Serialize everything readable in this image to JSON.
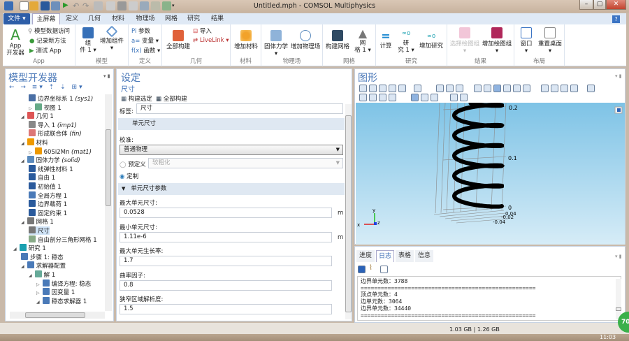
{
  "window": {
    "title": "Untitled.mph - COMSOL Multiphysics",
    "help": "?"
  },
  "menu_tabs": [
    "文件 ▾",
    "主屏幕",
    "定义",
    "几何",
    "材料",
    "物理场",
    "网格",
    "研究",
    "结果"
  ],
  "ribbon": {
    "app": {
      "group": "App",
      "big": "App\n开发器",
      "items": [
        "模型数据访问",
        "记录新方法",
        "测试 App"
      ]
    },
    "model": {
      "group": "模型",
      "component": "组\n件 1 ▾",
      "add_component": "增加组件\n▾"
    },
    "definitions": {
      "group": "定义",
      "items": [
        "参数",
        "变量 ▾",
        "函数 ▾"
      ],
      "prefix": [
        "Pi",
        "a=",
        "f(x)"
      ]
    },
    "geometry": {
      "group": "几何",
      "build_all": "全部构建",
      "import": "导入",
      "livelink": "LiveLink ▾"
    },
    "materials": {
      "group": "材料",
      "add": "增加材料"
    },
    "physics": {
      "group": "物理场",
      "solid": "固体力学\n▾",
      "add": "增加物理场"
    },
    "mesh": {
      "group": "网格",
      "build": "构建网格",
      "mesh1": "网\n格 1 ▾"
    },
    "study": {
      "group": "研究",
      "compute": "计算",
      "study1": "研\n究 1 ▾",
      "add": "增加研究"
    },
    "results": {
      "group": "结果",
      "select": "选择绘图组\n▾",
      "add": "增加绘图组\n▾"
    },
    "layout": {
      "group": "布局",
      "window": "窗口\n▾",
      "reset": "重置桌面\n▾"
    }
  },
  "model_builder": {
    "title": "模型开发器",
    "tree": [
      {
        "label": "边界坐标系 1",
        "tag": "(sys1)"
      },
      {
        "label": "视图 1",
        "tag": ""
      },
      {
        "label": "几何 1",
        "tag": ""
      },
      {
        "label": "导入 1",
        "tag": "(imp1)"
      },
      {
        "label": "形成联合体",
        "tag": "(fin)"
      },
      {
        "label": "材料",
        "tag": ""
      },
      {
        "label": "60Si2Mn",
        "tag": "(mat1)"
      },
      {
        "label": "固体力学",
        "tag": "(solid)"
      },
      {
        "label": "线弹性材料 1",
        "tag": ""
      },
      {
        "label": "自由 1",
        "tag": ""
      },
      {
        "label": "初始值 1",
        "tag": ""
      },
      {
        "label": "全局方程 1",
        "tag": ""
      },
      {
        "label": "边界载荷 1",
        "tag": ""
      },
      {
        "label": "固定约束 1",
        "tag": ""
      },
      {
        "label": "网格 1",
        "tag": ""
      },
      {
        "label": "尺寸",
        "tag": ""
      },
      {
        "label": "自由剖分三角形网格 1",
        "tag": ""
      },
      {
        "label": "研究 1",
        "tag": ""
      },
      {
        "label": "步骤 1: 稳态",
        "tag": ""
      },
      {
        "label": "求解器配置",
        "tag": ""
      },
      {
        "label": "解 1",
        "tag": ""
      },
      {
        "label": "编译方程: 稳态",
        "tag": ""
      },
      {
        "label": "因变量 1",
        "tag": ""
      },
      {
        "label": "稳态求解器 1",
        "tag": ""
      }
    ]
  },
  "settings": {
    "title": "设定",
    "subtitle": "尺寸",
    "build_selected": "构建选定",
    "build_all": "全部构建",
    "label_caption": "标签:",
    "label_value": "尺寸",
    "section1": "单元尺寸",
    "calibration_label": "校准:",
    "calibration_value": "普通物理",
    "predefined": "预定义",
    "predefined_value": "较粗化",
    "custom": "定制",
    "section2": "单元尺寸参数",
    "params": [
      {
        "label": "最大单元尺寸:",
        "value": "0.0528",
        "unit": "m"
      },
      {
        "label": "最小单元尺寸:",
        "value": "1.11e-6",
        "unit": "m"
      },
      {
        "label": "最大单元生长率:",
        "value": "1.7",
        "unit": ""
      },
      {
        "label": "曲率因子:",
        "value": "0.8",
        "unit": ""
      },
      {
        "label": "狭窄区域解析度:",
        "value": "1.5",
        "unit": ""
      }
    ]
  },
  "graphics": {
    "title": "图形",
    "axis_labels": [
      "0.2",
      "0.1",
      "0",
      "0.04",
      "-0.02",
      "-0.04"
    ],
    "triad": [
      "x",
      "y",
      "z"
    ]
  },
  "log": {
    "tabs": [
      "进度",
      "日志",
      "表格",
      "信息"
    ],
    "active": 1,
    "lines": [
      "边界单元数：3788",
      "====================================================",
      "顶点单元数：4",
      "边单元数：3064",
      "边界单元数：34440",
      "===================================================="
    ]
  },
  "status": {
    "memory": "1.03 GB | 1.26 GB",
    "clock": "11:03",
    "badge": "70"
  }
}
